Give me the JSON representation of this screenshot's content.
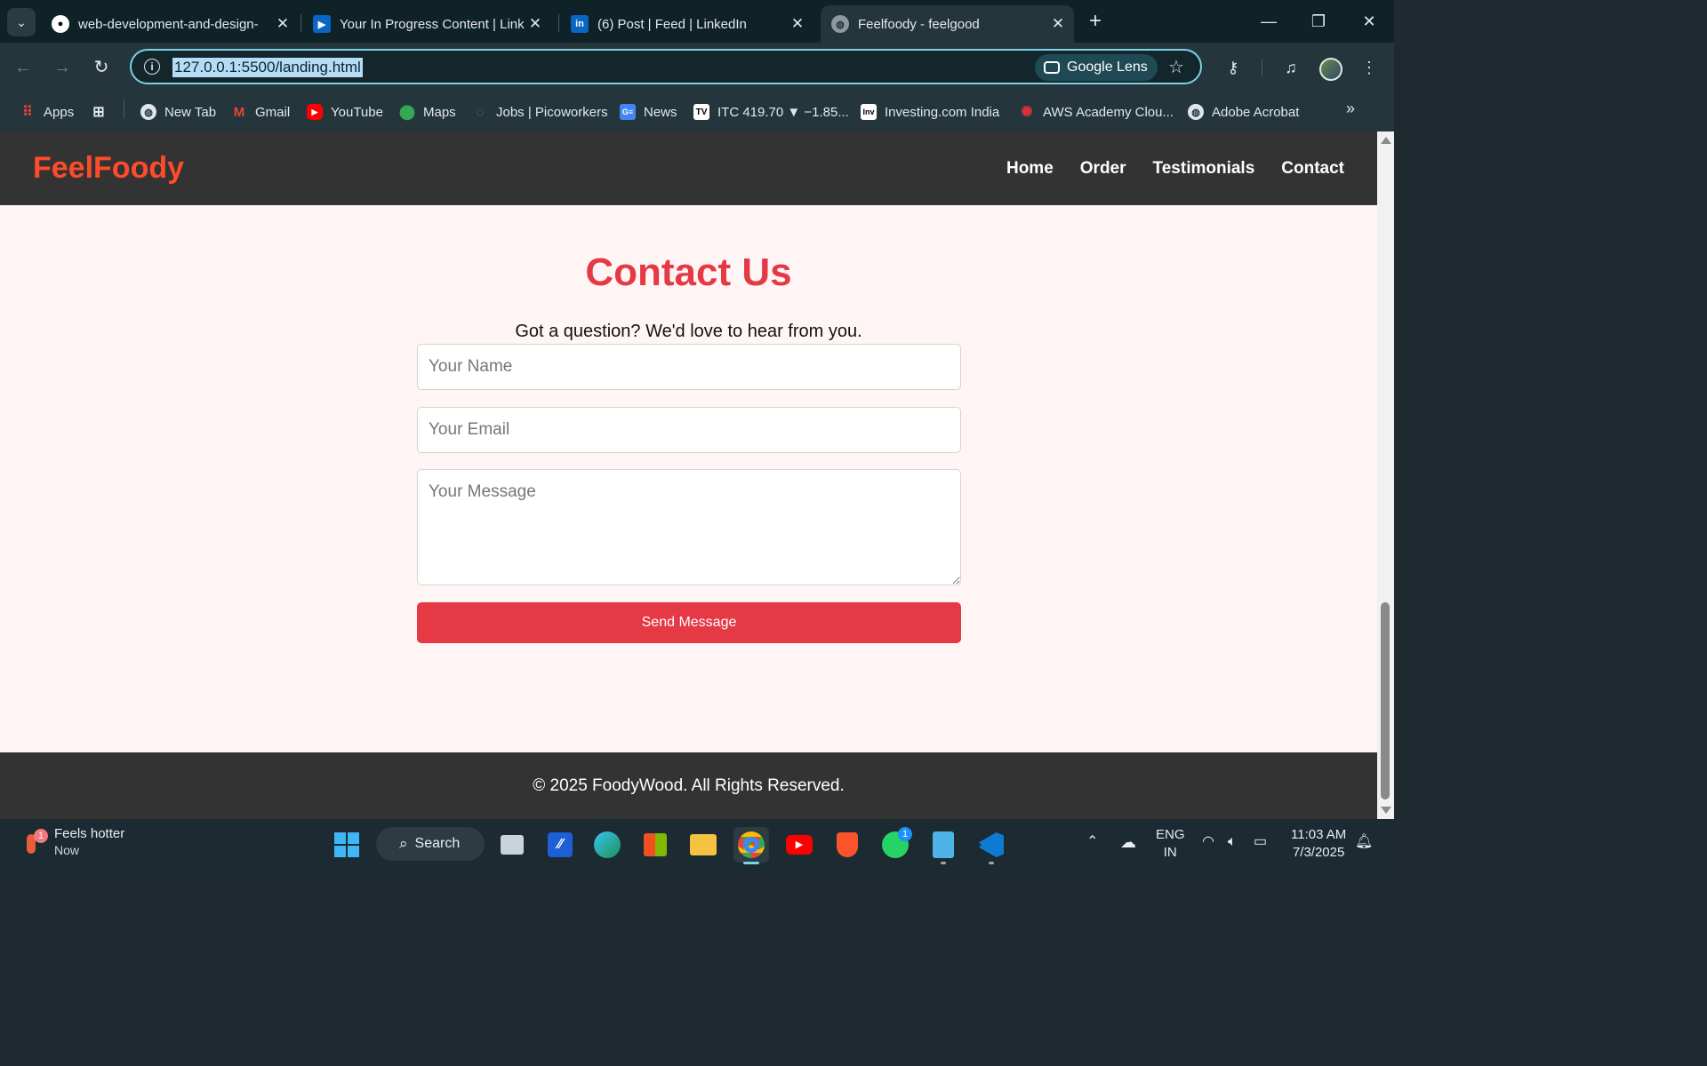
{
  "browser": {
    "tabs": [
      {
        "title": "web-development-and-design-",
        "icon": "github-icon",
        "active": false
      },
      {
        "title": "Your In Progress Content | Link",
        "icon": "linkedin-learning-icon",
        "active": false
      },
      {
        "title": "(6) Post | Feed | LinkedIn",
        "icon": "linkedin-icon",
        "active": false
      },
      {
        "title": "Feelfoody - feelgood",
        "icon": "globe-icon",
        "active": true
      }
    ],
    "url": "127.0.0.1:5500/landing.html",
    "lens_label": "Google Lens",
    "bookmarks": [
      {
        "label": "Apps",
        "icon": "apps-grid-icon"
      },
      {
        "label": "",
        "icon": "tab-groups-icon"
      },
      {
        "label": "New Tab",
        "icon": "globe-icon"
      },
      {
        "label": "Gmail",
        "icon": "gmail-icon"
      },
      {
        "label": "YouTube",
        "icon": "youtube-icon"
      },
      {
        "label": "Maps",
        "icon": "maps-pin-icon"
      },
      {
        "label": "Jobs | Picoworkers",
        "icon": "picoworkers-icon"
      },
      {
        "label": "News",
        "icon": "google-news-icon"
      },
      {
        "label": "ITC 419.70 ▼ −1.85...",
        "icon": "tradingview-icon"
      },
      {
        "label": "Investing.com India",
        "icon": "investing-icon"
      },
      {
        "label": "AWS Academy Clou...",
        "icon": "aws-academy-icon"
      },
      {
        "label": "Adobe Acrobat",
        "icon": "globe-icon"
      }
    ]
  },
  "site": {
    "logo": "FeelFoody",
    "nav": [
      "Home",
      "Order",
      "Testimonials",
      "Contact"
    ],
    "contact": {
      "title": "Contact Us",
      "subtitle": "Got a question? We'd love to hear from you.",
      "name_placeholder": "Your Name",
      "email_placeholder": "Your Email",
      "message_placeholder": "Your Message",
      "send_label": "Send Message"
    },
    "footer": "© 2025 FoodyWood. All Rights Reserved.",
    "colors": {
      "accent": "#e63946",
      "logo": "#ff4b2b",
      "header_bg": "#333333",
      "page_bg": "#fff5f5"
    }
  },
  "taskbar": {
    "weather_title": "Feels hotter",
    "weather_sub": "Now",
    "weather_badge": "1",
    "search_label": "Search",
    "whatsapp_badge": "1",
    "lang_line1": "ENG",
    "lang_line2": "IN",
    "time": "11:03 AM",
    "date": "7/3/2025"
  }
}
